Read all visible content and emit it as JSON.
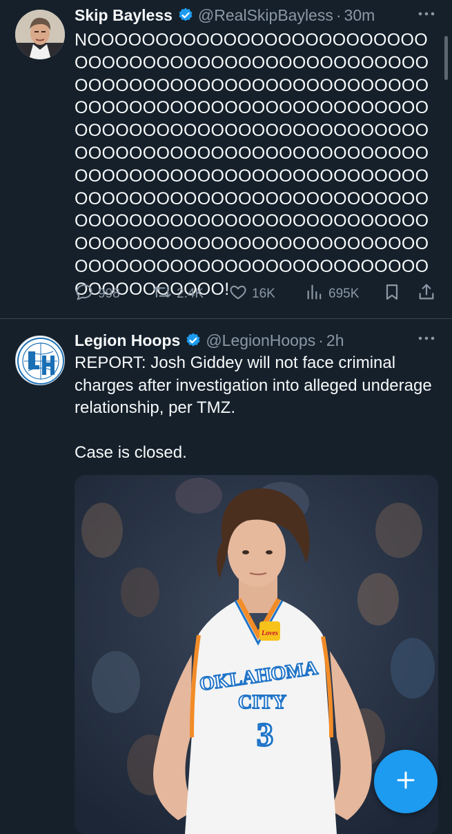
{
  "tweets": [
    {
      "name": "Skip Bayless",
      "handle": "@RealSkipBayless",
      "separator": "·",
      "time": "30m",
      "text": "NOOOOOOOOOOOOOOOOOOOOOOOOOOOOOOOOOOOOOOOOOOOOOOOOOOOOOOOOOOOOOOOOOOOOOOOOOOOOOOOOOOOOOOOOOOOOOOOOOOOOOOOOOOOOOOOOOOOOOOOOOOOOOOOOOOOOOOOOOOOOOOOOOOOOOOOOOOOOOOOOOOOOOOOOOOOOOOOOOOOOOOOOOOOOOOOOOOOOOOOOOOOOOOOOOOOOOOOOOOOOOOOOOOOOOOOOOOOOOOOOOOOOOOOOOOOOOOOOOOOOOOOOOOOOOOOOOOOOOOOOOOOOOOOOOOOOOOOO!",
      "actions": {
        "replies": "998",
        "retweets": "2.4K",
        "likes": "16K",
        "views": "695K"
      }
    },
    {
      "name": "Legion Hoops",
      "handle": "@LegionHoops",
      "separator": "·",
      "time": "2h",
      "text": "REPORT: Josh Giddey will not face criminal charges after investigation into alleged underage relationship, per TMZ.\n\nCase is closed.",
      "image": {
        "jersey_text_line1": "OKLAHOMA",
        "jersey_text_line2": "CITY",
        "jersey_number": "3",
        "patch_text": "Loves"
      }
    }
  ],
  "colors": {
    "background": "#15202b",
    "text": "#f7f9f9",
    "muted": "#8b98a5",
    "accent": "#1d9bf0"
  },
  "icons": [
    "verified-badge-icon",
    "more-icon",
    "reply-icon",
    "retweet-icon",
    "like-icon",
    "views-icon",
    "bookmark-icon",
    "share-icon",
    "compose-plus-icon"
  ]
}
